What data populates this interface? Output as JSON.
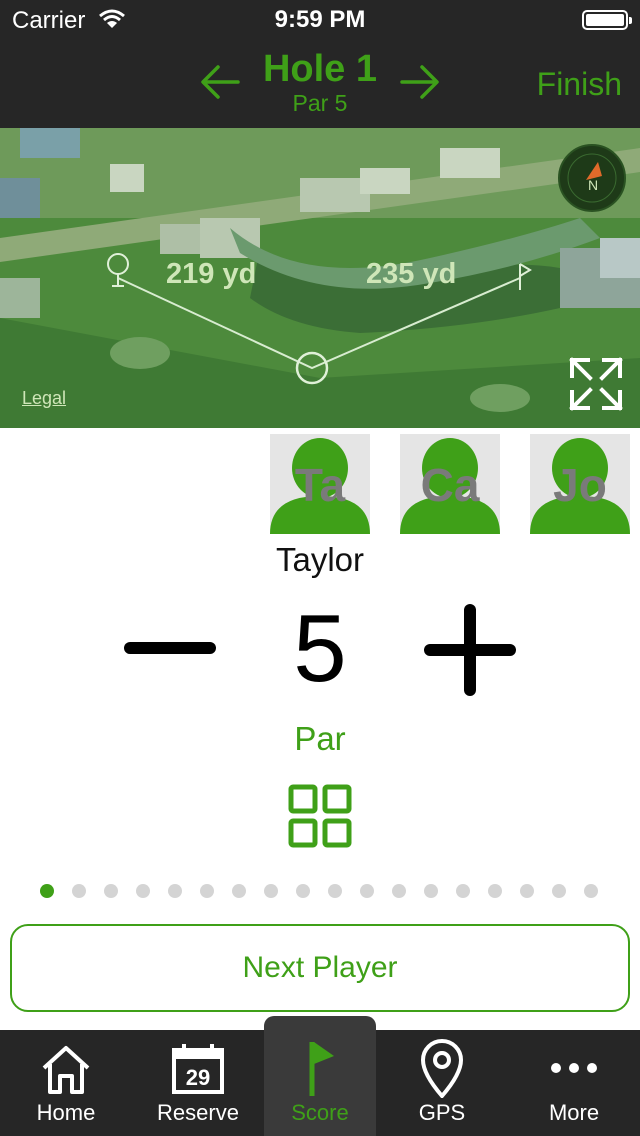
{
  "status_bar": {
    "carrier": "Carrier",
    "time": "9:59 PM"
  },
  "nav": {
    "title": "Hole 1",
    "subtitle": "Par 5",
    "finish_label": "Finish"
  },
  "map": {
    "distance_1": "219 yd",
    "distance_2": "235 yd",
    "legal": "Legal"
  },
  "players": [
    {
      "initials": "Ta"
    },
    {
      "initials": "Ca"
    },
    {
      "initials": "Jo"
    }
  ],
  "current_player": {
    "name": "Taylor",
    "score": "5",
    "score_label": "Par"
  },
  "pager": {
    "total": 18,
    "active_index": 0
  },
  "next_player_label": "Next Player",
  "tabs": [
    {
      "label": "Home",
      "icon": "home-icon"
    },
    {
      "label": "Reserve",
      "icon": "calendar-icon",
      "icon_text": "29"
    },
    {
      "label": "Score",
      "icon": "flag-icon"
    },
    {
      "label": "GPS",
      "icon": "map-pin-icon"
    },
    {
      "label": "More",
      "icon": "more-icon"
    }
  ],
  "colors": {
    "accent": "#3fa018",
    "bar": "#262626"
  }
}
